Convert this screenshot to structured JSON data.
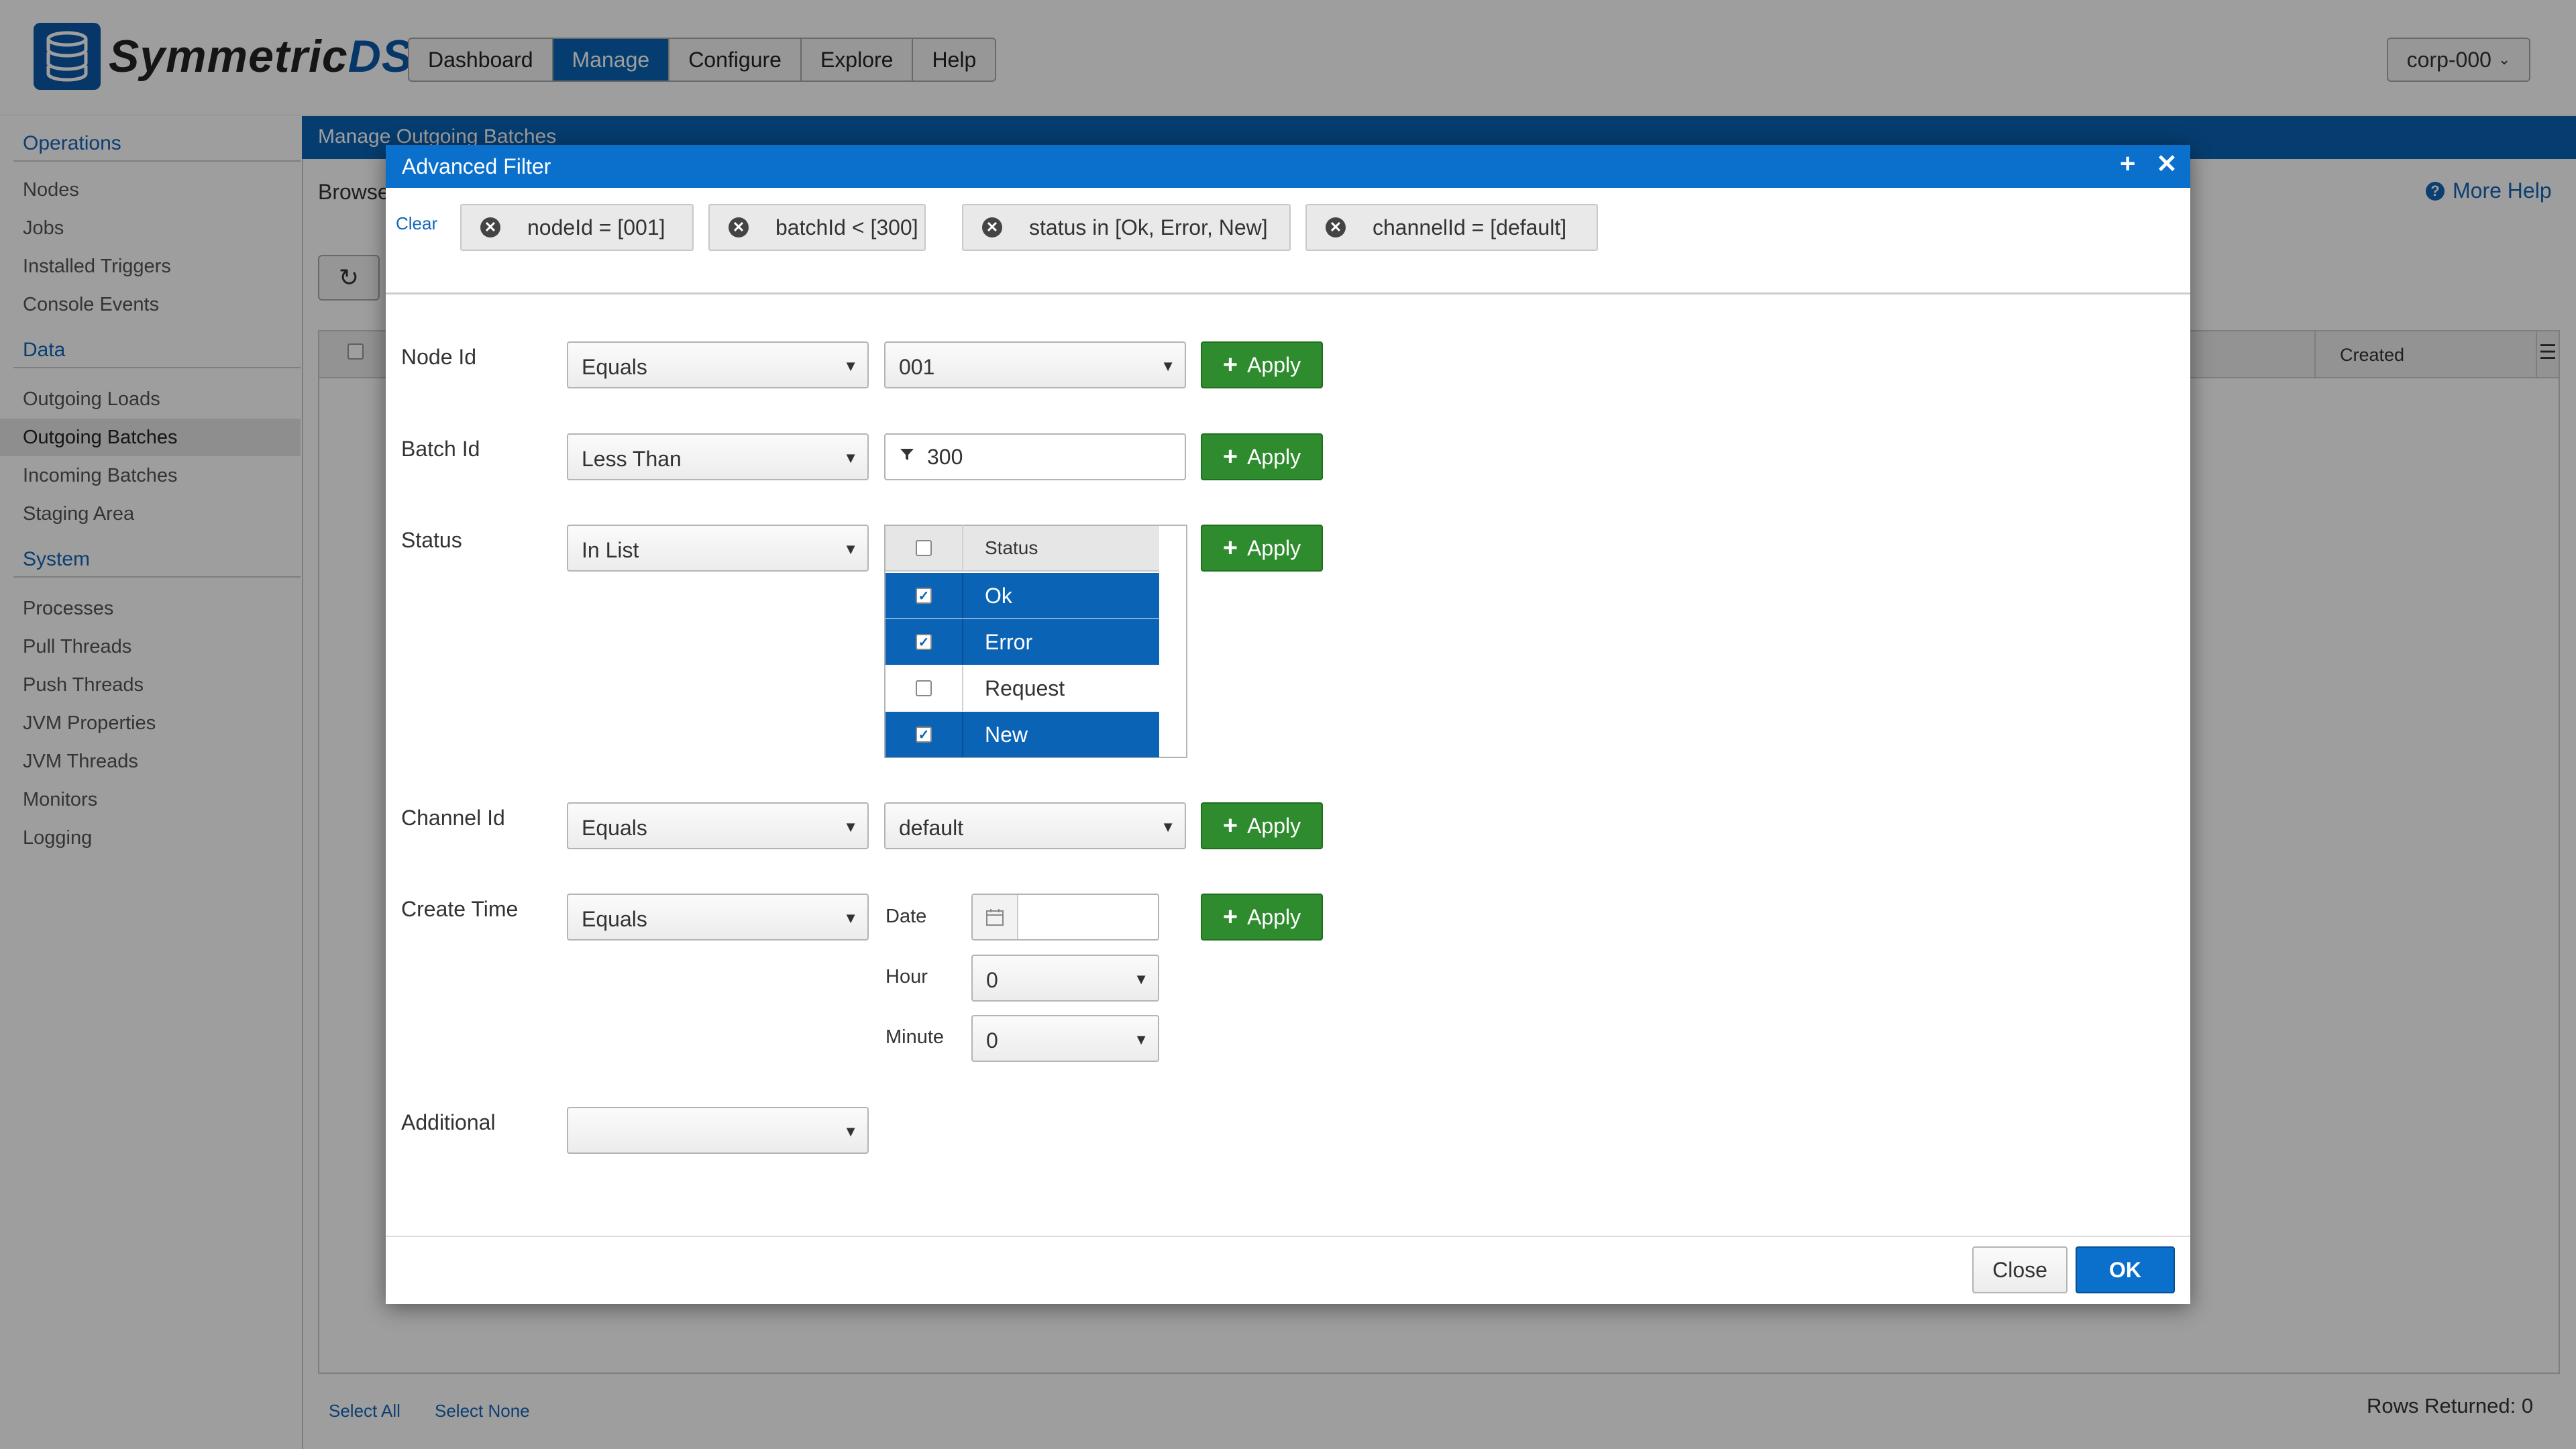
{
  "app": {
    "logo_text": "Symmetric",
    "logo_text_accent": "DS"
  },
  "topnav": {
    "items": [
      "Dashboard",
      "Manage",
      "Configure",
      "Explore",
      "Help"
    ],
    "active": "Manage"
  },
  "node_selector": {
    "value": "corp-000"
  },
  "sidebar": {
    "sections": [
      {
        "title": "Operations",
        "items": [
          "Nodes",
          "Jobs",
          "Installed Triggers",
          "Console Events"
        ]
      },
      {
        "title": "Data",
        "items": [
          "Outgoing Loads",
          "Outgoing Batches",
          "Incoming Batches",
          "Staging Area"
        ]
      },
      {
        "title": "System",
        "items": [
          "Processes",
          "Pull Threads",
          "Push Threads",
          "JVM Properties",
          "JVM Threads",
          "Monitors",
          "Logging"
        ]
      }
    ],
    "active_item": "Outgoing Batches"
  },
  "main": {
    "title": "Manage Outgoing Batches",
    "browse_label": "Browse",
    "more_help": "More Help",
    "grid": {
      "columns": [
        "Created"
      ]
    },
    "select_all": "Select All",
    "select_none": "Select None",
    "rows_returned": "Rows Returned: 0"
  },
  "modal": {
    "title": "Advanced Filter",
    "clear": "Clear",
    "chips": [
      "nodeId = [001]",
      "batchId < [300]",
      "status in [Ok, Error, New]",
      "channelId = [default]"
    ],
    "rows": {
      "node_id": {
        "label": "Node Id",
        "operator": "Equals",
        "value": "001"
      },
      "batch_id": {
        "label": "Batch Id",
        "operator": "Less Than",
        "value": "300"
      },
      "status": {
        "label": "Status",
        "operator": "In List",
        "list_header": "Status",
        "options": [
          {
            "label": "Ok",
            "checked": true
          },
          {
            "label": "Error",
            "checked": true
          },
          {
            "label": "Request",
            "checked": false
          },
          {
            "label": "New",
            "checked": true
          }
        ]
      },
      "channel_id": {
        "label": "Channel Id",
        "operator": "Equals",
        "value": "default"
      },
      "create_time": {
        "label": "Create Time",
        "operator": "Equals",
        "date_label": "Date",
        "date_value": "",
        "hour_label": "Hour",
        "hour_value": "0",
        "minute_label": "Minute",
        "minute_value": "0"
      },
      "additional": {
        "label": "Additional",
        "value": ""
      }
    },
    "apply_label": "Apply",
    "close_label": "Close",
    "ok_label": "OK"
  },
  "colors": {
    "primary": "#0a63b5",
    "apply_green": "#2e8b2e",
    "modal_title": "#0a70cc"
  }
}
